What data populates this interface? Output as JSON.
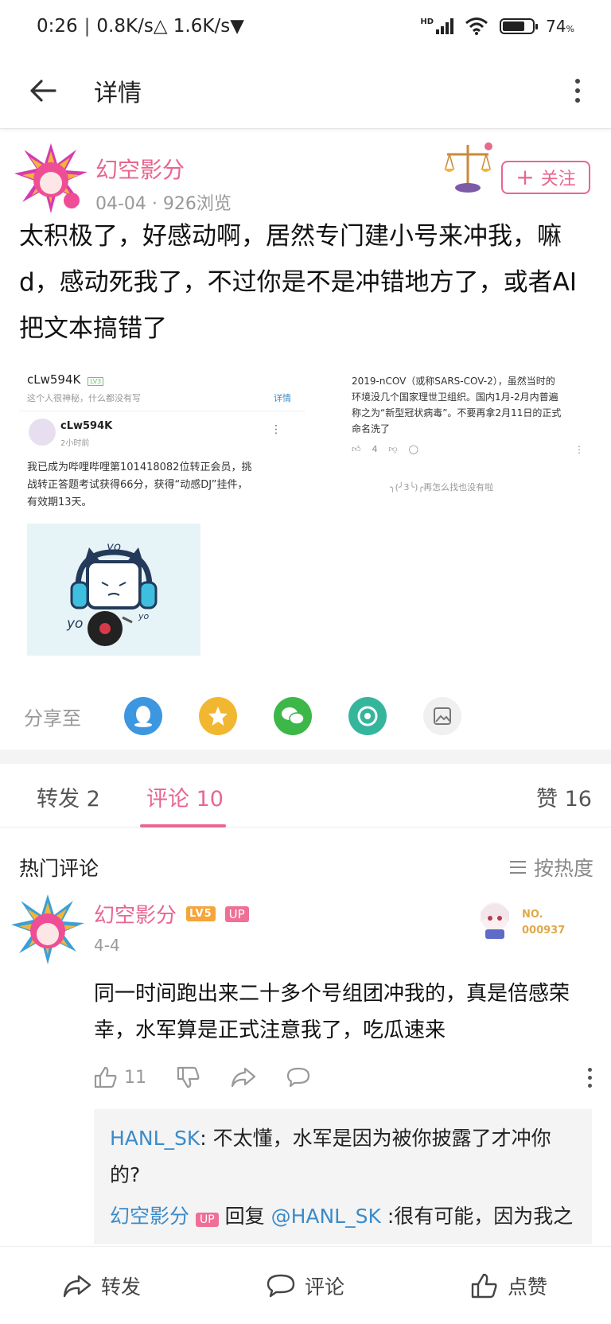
{
  "status_bar": {
    "time": "0:26",
    "network": "0.8K/s△ 1.6K/s▼",
    "hd": "HD",
    "battery": "74",
    "battery_level": 0.74
  },
  "header": {
    "title": "详情"
  },
  "post": {
    "author": "幻空影分",
    "meta": "04-04 · 926浏览",
    "follow_label": "关注",
    "text": "太积极了，好感动啊，居然专门建小号来冲我，嘛d，感动死我了，不过你是不是冲错地方了，或者AI把文本搞错了",
    "screenshot_left": {
      "user": "cLw594K",
      "level": "LV3",
      "bio": "这个人很神秘，什么都没有写",
      "detail": "详情",
      "inner_user": "cLw594K",
      "inner_time": "2小时前",
      "inner_text_1": "我已成为哔哩哔哩第101418082位转正会员，挑",
      "inner_text_2": "战转正答题考试获得66分，获得“动感DJ”挂件，",
      "inner_text_3": "有效期13天。",
      "sticker_yo": "yo"
    },
    "screenshot_right": {
      "line1": "2019-nCOV（或称SARS-COV-2），虽然当时的",
      "line2": "环境没几个国家理世卫组织。国内1月-2月内普遍",
      "line3": "称之为“新型冠状病毒”。不要再拿2月11日的正式",
      "line4": "命名洗了",
      "likes": "4",
      "end_note": "╮(╯3╰)╭再怎么找也没有啦"
    },
    "share_label": "分享至",
    "share_icons": [
      "qq-icon",
      "qzone-icon",
      "wechat-icon",
      "moments-icon",
      "gallery-icon"
    ]
  },
  "tabs": {
    "repost": "转发 2",
    "comments": "评论 10",
    "likes": "赞 16"
  },
  "hot_comments": {
    "title": "热门评论",
    "sort": "按热度"
  },
  "comment": {
    "author": "幻空影分",
    "level": "LV5",
    "up_badge": "UP",
    "date": "4-4",
    "fan_no_label": "NO.",
    "fan_no_value": "000937",
    "text": "同一时间跑出来二十多个号组团冲我的，真是倍感荣幸，水军算是正式注意我了，吃瓜速来",
    "likes": "11",
    "replies": [
      {
        "name": "HANL_SK",
        "text": ": 不太懂，水军是因为被你披露了才冲你的?"
      },
      {
        "name": "幻空影分",
        "badge": "UP",
        "reply_word": " 回复 ",
        "target": "@HANL_SK",
        "text": " :很有可能，因为我之前披露过水军操作，他们一直在盯着我"
      }
    ]
  },
  "bottom_bar": {
    "repost": "转发",
    "comment": "评论",
    "like": "点赞"
  },
  "colors": {
    "accent": "#e9668f",
    "link_blue": "#3b8bc9",
    "up_badge": "#ef6f96",
    "level_badge": "#f5a53a"
  }
}
